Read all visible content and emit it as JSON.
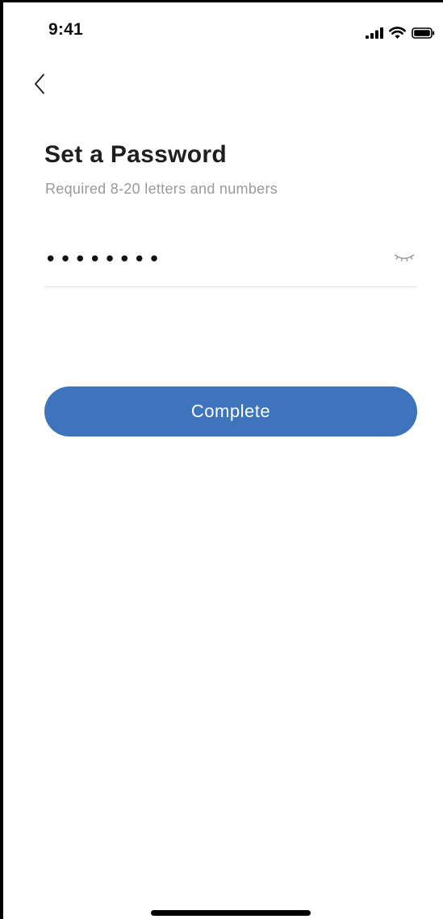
{
  "status_bar": {
    "time": "9:41",
    "icons": [
      "cellular-signal-icon",
      "wifi-icon",
      "battery-icon"
    ]
  },
  "navigation": {
    "back_icon": "chevron-left-icon"
  },
  "header": {
    "title": "Set a Password",
    "subtitle": "Required 8-20 letters and numbers"
  },
  "password_field": {
    "value": "password",
    "masked": true,
    "toggle_icon": "eye-closed-icon"
  },
  "actions": {
    "complete_label": "Complete"
  },
  "colors": {
    "accent": "#3d74bb",
    "title": "#1e1e1e",
    "subtitle": "#9a9a9a",
    "divider": "#e4e4e4"
  }
}
